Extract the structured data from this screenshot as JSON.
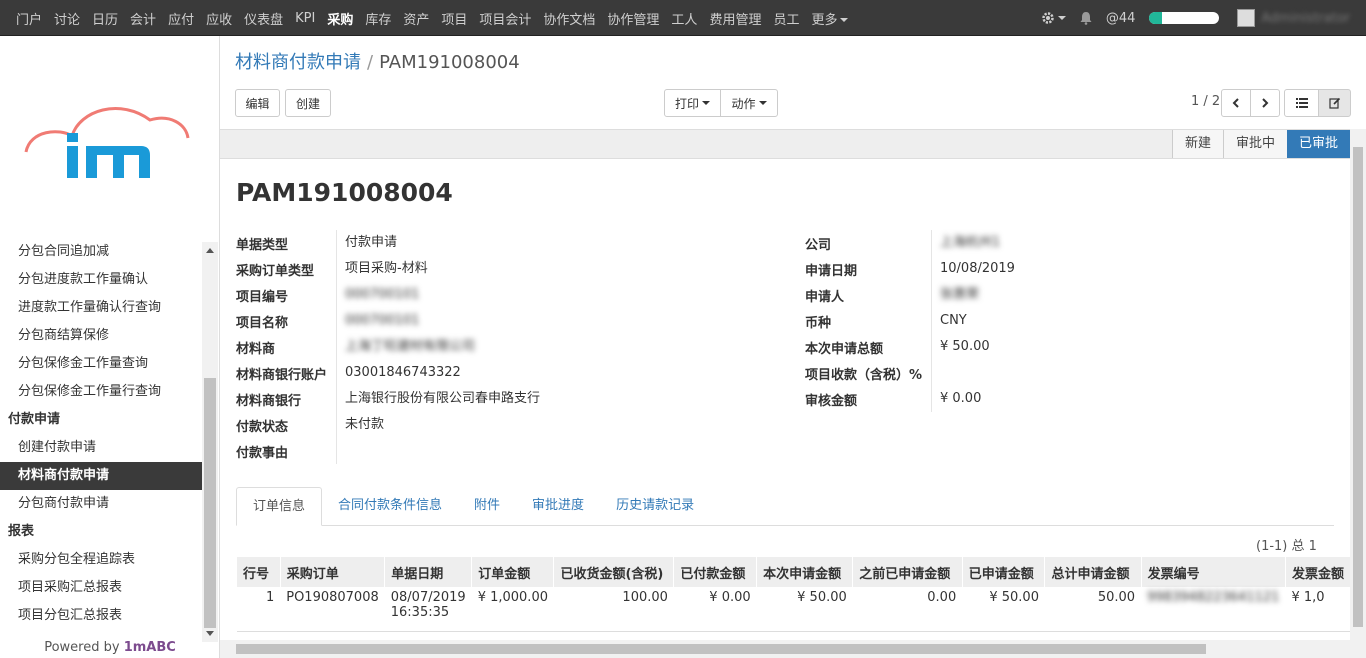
{
  "topnav": {
    "items": [
      "门户",
      "讨论",
      "日历",
      "会计",
      "应付",
      "应收",
      "仪表盘",
      "KPI",
      "采购",
      "库存",
      "资产",
      "项目",
      "项目会计",
      "协作文档",
      "协作管理",
      "工人",
      "费用管理",
      "员工"
    ],
    "active_index": 8,
    "more_label": "更多"
  },
  "topright": {
    "at_count": "@44",
    "progress_fraction": 0.18,
    "username": "Administrator"
  },
  "sidebar": {
    "items": [
      {
        "label": "分包合同追加减",
        "kind": "item"
      },
      {
        "label": "分包进度款工作量确认",
        "kind": "item"
      },
      {
        "label": "进度款工作量确认行查询",
        "kind": "item"
      },
      {
        "label": "分包商结算保修",
        "kind": "item"
      },
      {
        "label": "分包保修金工作量查询",
        "kind": "item"
      },
      {
        "label": "分包保修金工作量行查询",
        "kind": "item"
      },
      {
        "label": "付款申请",
        "kind": "header"
      },
      {
        "label": "创建付款申请",
        "kind": "item"
      },
      {
        "label": "材料商付款申请",
        "kind": "active"
      },
      {
        "label": "分包商付款申请",
        "kind": "item"
      },
      {
        "label": "报表",
        "kind": "header"
      },
      {
        "label": "采购分包全程追踪表",
        "kind": "item"
      },
      {
        "label": "项目采购汇总报表",
        "kind": "item"
      },
      {
        "label": "项目分包汇总报表",
        "kind": "item"
      }
    ],
    "powered_prefix": "Powered by ",
    "powered_brand": "1mABC"
  },
  "breadcrumb": {
    "parent": "材料商付款申请",
    "sep": "/",
    "current": "PAM191008004"
  },
  "toolbar": {
    "edit": "编辑",
    "create": "创建",
    "print": "打印",
    "action": "动作",
    "pager": "1 / 2"
  },
  "stages": [
    "新建",
    "审批中",
    "已审批"
  ],
  "stage_current_index": 2,
  "document": {
    "title": "PAM191008004",
    "left_fields": [
      {
        "label": "单据类型",
        "value": "付款申请",
        "style": ""
      },
      {
        "label": "采购订单类型",
        "value": "项目采购-材料",
        "style": ""
      },
      {
        "label": "项目编号",
        "value": "000700101",
        "style": "link blur"
      },
      {
        "label": "项目名称",
        "value": "000700101",
        "style": "blur"
      },
      {
        "label": "材料商",
        "value": "上海丁旺建材有限公司",
        "style": "link blur"
      },
      {
        "label": "材料商银行账户",
        "value": "03001846743322",
        "style": ""
      },
      {
        "label": "材料商银行",
        "value": "上海银行股份有限公司春申路支行",
        "style": ""
      },
      {
        "label": "付款状态",
        "value": "未付款",
        "style": ""
      },
      {
        "label": "付款事由",
        "value": "",
        "style": ""
      }
    ],
    "right_fields": [
      {
        "label": "公司",
        "value": "上海杭州1",
        "style": "blur"
      },
      {
        "label": "申请日期",
        "value": "10/08/2019",
        "style": ""
      },
      {
        "label": "申请人",
        "value": "张惠荣",
        "style": "blur"
      },
      {
        "label": "币种",
        "value": "CNY",
        "style": ""
      },
      {
        "label": "本次申请总额",
        "value": "¥ 50.00",
        "style": ""
      },
      {
        "label": "项目收款（含税）%",
        "value": "",
        "style": ""
      },
      {
        "label": "审核金额",
        "value": "¥ 0.00",
        "style": ""
      }
    ]
  },
  "tabs": [
    "订单信息",
    "合同付款条件信息",
    "附件",
    "审批进度",
    "历史请款记录"
  ],
  "active_tab": 0,
  "table": {
    "count": "(1-1) 总 1",
    "columns": [
      "行号",
      "采购订单",
      "单据日期",
      "订单金额",
      "已收货金额(含税)",
      "已付款金额",
      "本次申请金额",
      "之前已申请金额",
      "已申请金额",
      "总计申请金额",
      "发票编号",
      "发票金额"
    ],
    "rows": [
      {
        "line": "1",
        "po": "PO190807008",
        "date": "08/07/2019",
        "time": "16:35:35",
        "order_amount": "¥ 1,000.00",
        "received": "100.00",
        "paid": "¥ 0.00",
        "request": "¥ 50.00",
        "prev_requested": "0.00",
        "requested": "¥ 50.00",
        "total_requested": "50.00",
        "invoice_no": "9983948223641121",
        "invoice_amount": "¥ 1,0"
      }
    ]
  }
}
